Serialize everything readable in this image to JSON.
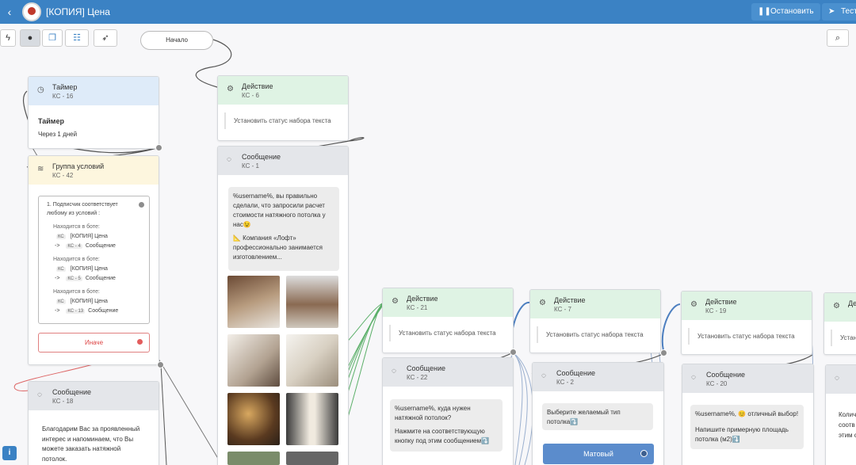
{
  "header": {
    "back_icon": "chevron-left-icon",
    "title": "[КОПИЯ] Цена",
    "stop_label": "Остановить",
    "test_label": "Тест"
  },
  "toolbar": {
    "buttons": [
      "bolt-icon",
      "user-icon",
      "copy-icon",
      "network-icon",
      "rocket-icon"
    ]
  },
  "start_label": "Начало",
  "timer": {
    "title": "Таймер",
    "id": "КС - 16",
    "heading": "Таймер",
    "text": "Через 1 дней"
  },
  "group": {
    "title": "Группа условий",
    "id": "КС - 42",
    "cond_title_1": "1. Подписчик соответствует",
    "cond_title_2": "любому из условий :",
    "in_bot": "Находится в боте:",
    "bot_name": "[КОПИЯ] Цена",
    "kc": "КС",
    "arrow": "->",
    "msg": "Сообщение",
    "kc4": "КС - 4",
    "kc5": "КС - 5",
    "kc13": "КС - 13",
    "else_label": "Иначе"
  },
  "msg18": {
    "title": "Сообщение",
    "id": "КС - 18",
    "text_1": "Благодарим Вас за проявленный",
    "text_2": "интерес и напоминаем, что Вы",
    "text_3": "можете заказать натяжной",
    "text_4": "потолок."
  },
  "action6": {
    "title": "Действие",
    "id": "КС - 6",
    "text": "Установить статус набора текста"
  },
  "msg1": {
    "title": "Сообщение",
    "id": "КС - 1",
    "text_1": "%username%, вы правильно",
    "text_2": "сделали, что запросили расчет",
    "text_3": "стоимости натяжного потолка у",
    "text_4": "нас😉",
    "text_5": "📐 Компания «Лофт»",
    "text_6": "профессионально занимается",
    "text_7": "изготовлением..."
  },
  "action21": {
    "title": "Действие",
    "id": "КС - 21",
    "text": "Установить статус набора текста"
  },
  "msg22": {
    "title": "Сообщение",
    "id": "КС - 22",
    "text_1": "%username%, куда нужен",
    "text_2": "натяжной потолок?",
    "text_3": "Нажмите на соответствующую",
    "text_4": "кнопку под этим сообщением⤵️"
  },
  "action7": {
    "title": "Действие",
    "id": "КС - 7",
    "text": "Установить статус набора текста"
  },
  "msg2": {
    "title": "Сообщение",
    "id": "КС - 2",
    "text_1": "Выберите желаемый тип",
    "text_2": "потолка⤵️",
    "button": "Матовый"
  },
  "action19": {
    "title": "Действие",
    "id": "КС - 19",
    "text": "Установить статус набора текста"
  },
  "msg20": {
    "title": "Сообщение",
    "id": "КС - 20",
    "text_1": "%username%, 😊 отличный выбор!",
    "text_2": "Напишите примерную площадь",
    "text_3": "потолка (м2)⤵️"
  },
  "action_right": {
    "title": "Дей",
    "text": "Устан"
  },
  "msg_right": {
    "text_1": "Колич",
    "text_2": "соотв",
    "text_3": "этим с"
  },
  "colors": {
    "header": "#3b82c4",
    "green_head": "#dff3e4",
    "blue_head": "#deebf9",
    "gray_head": "#e4e6ea",
    "yellow_head": "#fdf6de"
  }
}
